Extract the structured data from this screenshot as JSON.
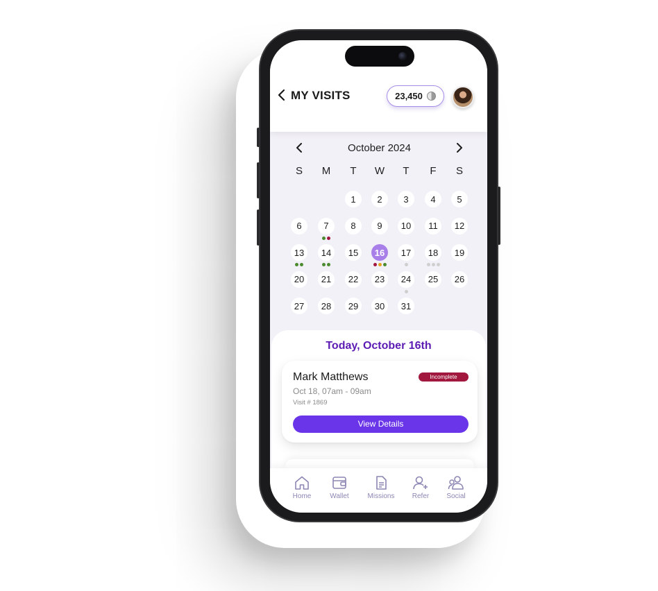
{
  "header": {
    "title": "MY VISITS",
    "points": "23,450"
  },
  "calendar": {
    "month": "October 2024",
    "weekdays": [
      "S",
      "M",
      "T",
      "W",
      "T",
      "F",
      "S"
    ],
    "selected_day": 16,
    "days": [
      {
        "d": "1"
      },
      {
        "d": "2"
      },
      {
        "d": "3"
      },
      {
        "d": "4"
      },
      {
        "d": "5"
      },
      {
        "d": "6"
      },
      {
        "d": "7",
        "dots": [
          "#4b8a2f",
          "#a1173d"
        ]
      },
      {
        "d": "8"
      },
      {
        "d": "9"
      },
      {
        "d": "10"
      },
      {
        "d": "11"
      },
      {
        "d": "12"
      },
      {
        "d": "13",
        "dots": [
          "#4b8a2f",
          "#4b8a2f"
        ]
      },
      {
        "d": "14",
        "dots": [
          "#4b8a2f",
          "#4b8a2f"
        ]
      },
      {
        "d": "15"
      },
      {
        "d": "16",
        "dots": [
          "#a1173d",
          "#e2a21e",
          "#4b8a2f"
        ]
      },
      {
        "d": "17",
        "dots": [
          "#cfcfcf"
        ]
      },
      {
        "d": "18",
        "dots": [
          "#cfcfcf",
          "#cfcfcf",
          "#cfcfcf"
        ]
      },
      {
        "d": "19"
      },
      {
        "d": "20"
      },
      {
        "d": "21"
      },
      {
        "d": "22"
      },
      {
        "d": "23"
      },
      {
        "d": "24",
        "dots": [
          "#cfcfcf"
        ]
      },
      {
        "d": "25"
      },
      {
        "d": "26"
      },
      {
        "d": "27"
      },
      {
        "d": "28"
      },
      {
        "d": "29"
      },
      {
        "d": "30"
      },
      {
        "d": "31"
      }
    ],
    "first_weekday": 2
  },
  "today": {
    "title": "Today, October 16th"
  },
  "visit": {
    "name": "Mark Matthews",
    "status": "Incomplete",
    "time": "Oct 18, 07am - 09am",
    "number": "Visit # 1869",
    "button_label": "View Details"
  },
  "nav": {
    "items": [
      {
        "label": "Home",
        "icon": "home-icon"
      },
      {
        "label": "Wallet",
        "icon": "wallet-icon"
      },
      {
        "label": "Missions",
        "icon": "document-icon"
      },
      {
        "label": "Refer",
        "icon": "add-user-icon"
      },
      {
        "label": "Social",
        "icon": "users-icon"
      }
    ]
  },
  "colors": {
    "accent": "#6a35e8",
    "selected_day": "#a87ee9",
    "today_title": "#5c1bb3",
    "incomplete": "#a1173d",
    "nav_label": "#8c86b3"
  }
}
